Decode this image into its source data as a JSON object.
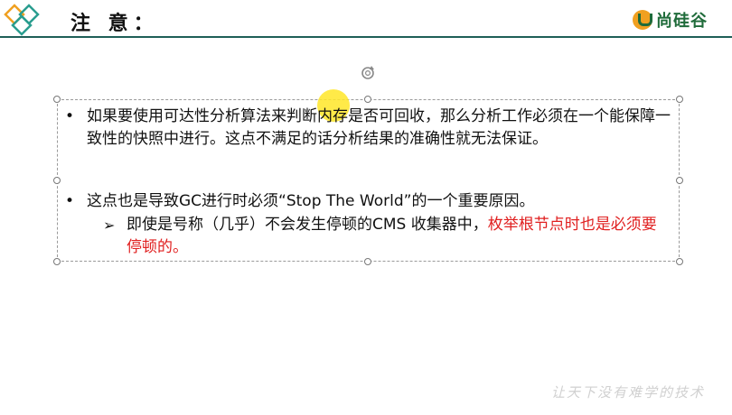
{
  "header": {
    "title": "注 意：",
    "logo_text": "尚硅谷"
  },
  "content": {
    "bullet1": "如果要使用可达性分析算法来判断内存是否可回收，那么分析工作必须在一个能保障一致性的快照中进行。这点不满足的话分析结果的准确性就无法保证。",
    "bullet2": "这点也是导致GC进行时必须“Stop The World”的一个重要原因。",
    "sub_bullet_black": "即使是号称（几乎）不会发生停顿的CMS 收集器中，",
    "sub_bullet_red": "枚举根节点时也是必须要停顿的。"
  },
  "watermark": "让天下没有难学的技术",
  "colors": {
    "header_line": "#1f5f57",
    "highlight_red": "#e02020",
    "cursor_highlight": "#ffe628",
    "logo_green": "#1f6b3a",
    "logo_orange": "#f0a020"
  }
}
